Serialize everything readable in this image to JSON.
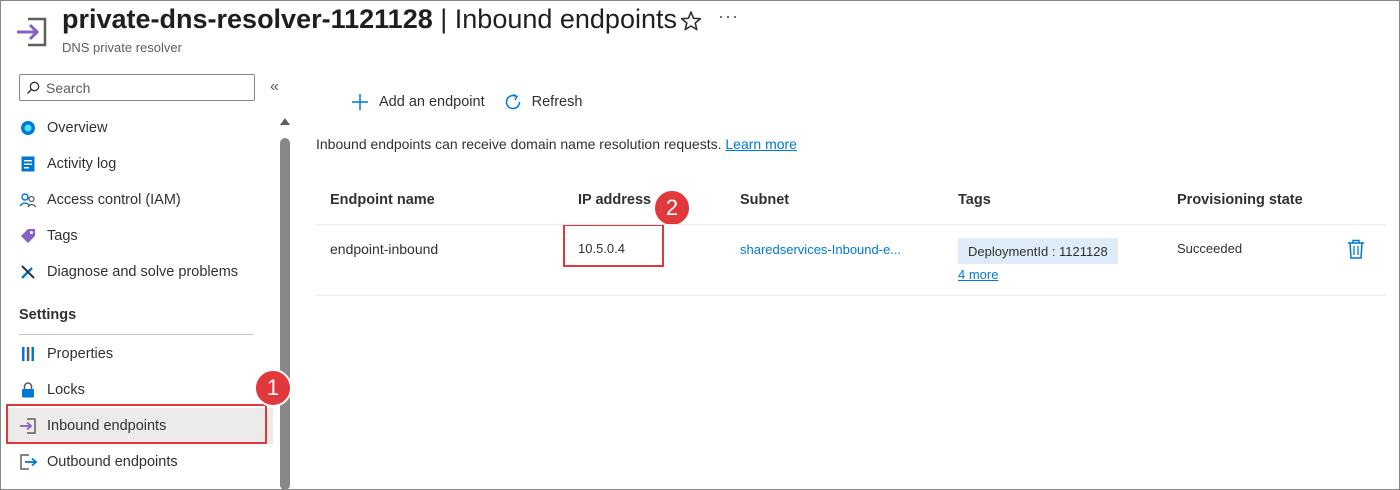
{
  "header": {
    "resource_name": "private-dns-resolver-1121128",
    "separator": "|",
    "page_name": "Inbound endpoints",
    "subtitle": "DNS private resolver",
    "more_label": "···"
  },
  "sidebar": {
    "search_placeholder": "Search",
    "collapse_label": "«",
    "items": [
      {
        "label": "Overview",
        "icon": "globe-icon"
      },
      {
        "label": "Activity log",
        "icon": "activity-log-icon"
      },
      {
        "label": "Access control (IAM)",
        "icon": "people-icon"
      },
      {
        "label": "Tags",
        "icon": "tag-icon"
      },
      {
        "label": "Diagnose and solve problems",
        "icon": "wrench-icon"
      }
    ],
    "settings_label": "Settings",
    "settings_items": [
      {
        "label": "Properties",
        "icon": "properties-icon"
      },
      {
        "label": "Locks",
        "icon": "lock-icon"
      },
      {
        "label": "Inbound endpoints",
        "icon": "inbound-icon",
        "active": true
      },
      {
        "label": "Outbound endpoints",
        "icon": "outbound-icon"
      }
    ]
  },
  "annotations": {
    "badge_1": "1",
    "badge_2": "2"
  },
  "toolbar": {
    "add_label": "Add an endpoint",
    "refresh_label": "Refresh"
  },
  "info": {
    "text": "Inbound endpoints can receive domain name resolution requests.",
    "link": "Learn more"
  },
  "table": {
    "columns": [
      "Endpoint name",
      "IP address",
      "Subnet",
      "Tags",
      "Provisioning state"
    ],
    "rows": [
      {
        "name": "endpoint-inbound",
        "ip": "10.5.0.4",
        "subnet": "sharedservices-Inbound-e...",
        "tag": "DeploymentId : 1121128",
        "more_tags": "4 more",
        "state": "Succeeded"
      }
    ]
  },
  "colors": {
    "accent": "#0078d4",
    "annotation": "#e0383b",
    "inbound_purple": "#8661c5",
    "tag_bg": "#deecf9"
  }
}
